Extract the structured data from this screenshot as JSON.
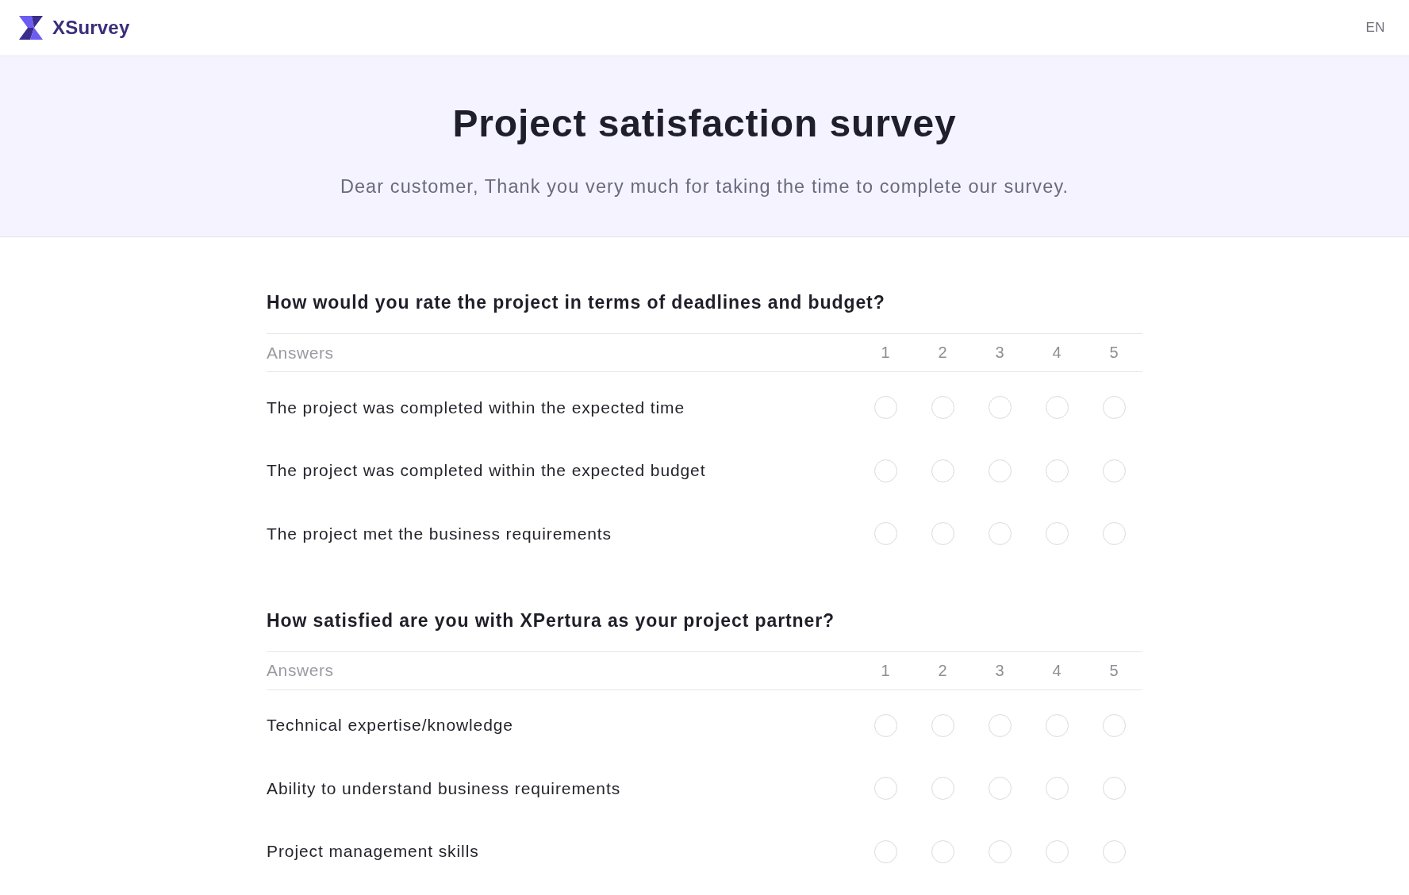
{
  "top_bar": {
    "brand": "XSurvey",
    "language": "EN"
  },
  "banner": {
    "title": "Project satisfaction survey",
    "subtitle": "Dear customer, Thank you very much for taking the time to complete our survey."
  },
  "questions": [
    {
      "title": "How would you rate the project in terms of deadlines and budget?",
      "answers_heading": "Answers",
      "scale": [
        "1",
        "2",
        "3",
        "4",
        "5"
      ],
      "rows": [
        {
          "label": "The project was completed within the expected time",
          "choices": [
            {
              "selected": false
            },
            {
              "selected": false
            },
            {
              "selected": false
            },
            {
              "selected": false
            },
            {
              "selected": false
            }
          ]
        },
        {
          "label": "The project was completed within the expected budget",
          "choices": [
            {
              "selected": false
            },
            {
              "selected": false
            },
            {
              "selected": false
            },
            {
              "selected": false
            },
            {
              "selected": false
            }
          ]
        },
        {
          "label": "The project met the business requirements",
          "choices": [
            {
              "selected": false
            },
            {
              "selected": false
            },
            {
              "selected": false
            },
            {
              "selected": false
            },
            {
              "selected": false
            }
          ]
        }
      ]
    },
    {
      "title": "How satisfied are you with XPertura as your project partner?",
      "answers_heading": "Answers",
      "scale": [
        "1",
        "2",
        "3",
        "4",
        "5"
      ],
      "rows": [
        {
          "label": "Technical expertise/knowledge",
          "choices": [
            {
              "selected": false
            },
            {
              "selected": false
            },
            {
              "selected": false
            },
            {
              "selected": false
            },
            {
              "selected": false
            }
          ]
        },
        {
          "label": "Ability to understand business requirements",
          "choices": [
            {
              "selected": false
            },
            {
              "selected": false
            },
            {
              "selected": false
            },
            {
              "selected": false
            },
            {
              "selected": false
            }
          ]
        },
        {
          "label": "Project management skills",
          "choices": [
            {
              "selected": false
            },
            {
              "selected": false
            },
            {
              "selected": false
            },
            {
              "selected": false
            },
            {
              "selected": false
            }
          ]
        }
      ]
    }
  ]
}
